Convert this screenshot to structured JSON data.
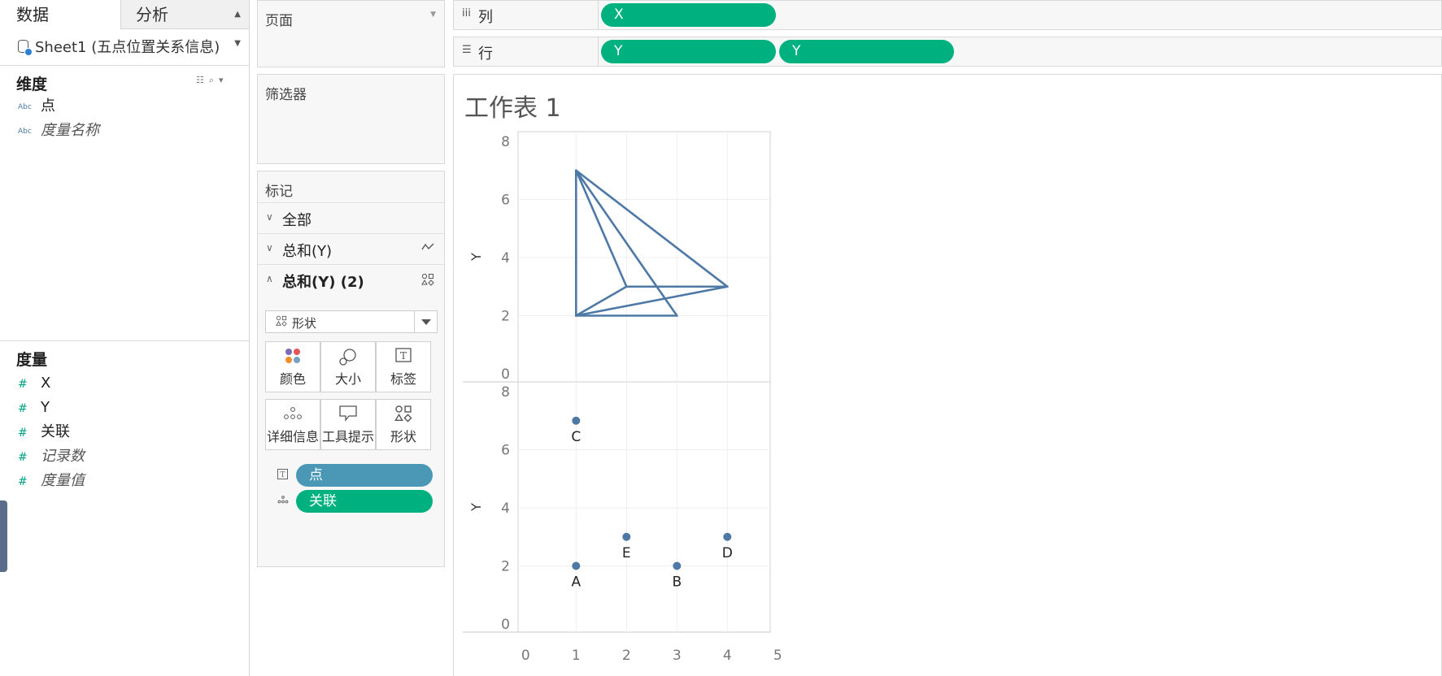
{
  "tabs": {
    "data": "数据",
    "analysis": "分析"
  },
  "datasource": {
    "name": "Sheet1 (五点位置关系信息)"
  },
  "dimensions": {
    "title": "维度",
    "fields": [
      {
        "icon": "abc-icon",
        "label": "点"
      },
      {
        "icon": "abc-icon",
        "label": "度量名称"
      }
    ]
  },
  "measures": {
    "title": "度量",
    "fields": [
      {
        "icon": "hash-icon",
        "label": "X"
      },
      {
        "icon": "hash-icon",
        "label": "Y"
      },
      {
        "icon": "hash-icon",
        "label": "关联"
      },
      {
        "icon": "hash-icon",
        "label": "记录数"
      },
      {
        "icon": "hash-icon",
        "label": "度量值"
      }
    ]
  },
  "cards": {
    "pages": "页面",
    "filters": "筛选器",
    "marks": {
      "title": "标记",
      "rows": [
        {
          "label": "全部",
          "expanded": false
        },
        {
          "label": "总和(Y)",
          "expanded": false,
          "icon": "line-icon"
        },
        {
          "label": "总和(Y) (2)",
          "expanded": true,
          "icon": "shape-icon"
        }
      ],
      "mark_type": "形状",
      "buttons": [
        "颜色",
        "大小",
        "标签",
        "详细信息",
        "工具提示",
        "形状"
      ],
      "pills": [
        {
          "icon": "label-icon",
          "label": "点",
          "color": "#4a98b6"
        },
        {
          "icon": "detail-icon",
          "label": "关联",
          "color": "#00b180"
        }
      ]
    }
  },
  "shelves": {
    "columns": {
      "label": "列",
      "pills": [
        "X"
      ]
    },
    "rows": {
      "label": "行",
      "pills": [
        "Y",
        "Y"
      ]
    }
  },
  "sheet": {
    "title": "工作表 1"
  },
  "colors": {
    "mark": "#4e79a7",
    "pill_green": "#00b180",
    "pill_blue": "#4a98b6"
  },
  "chart_data": [
    {
      "type": "line",
      "title": "",
      "xlabel": "X",
      "ylabel": "Y",
      "ylim": [
        0,
        8
      ],
      "yticks": [
        "0",
        "2",
        "4",
        "6",
        "8"
      ],
      "segments": [
        {
          "from": [
            1,
            7
          ],
          "to": [
            1,
            2
          ]
        },
        {
          "from": [
            1,
            7
          ],
          "to": [
            2,
            3
          ]
        },
        {
          "from": [
            1,
            7
          ],
          "to": [
            3,
            2
          ]
        },
        {
          "from": [
            1,
            7
          ],
          "to": [
            4,
            3
          ]
        },
        {
          "from": [
            1,
            2
          ],
          "to": [
            3,
            2
          ]
        },
        {
          "from": [
            1,
            2
          ],
          "to": [
            2,
            3
          ]
        },
        {
          "from": [
            1,
            2
          ],
          "to": [
            4,
            3
          ]
        },
        {
          "from": [
            2,
            3
          ],
          "to": [
            4,
            3
          ]
        }
      ]
    },
    {
      "type": "scatter",
      "title": "",
      "xlabel": "X",
      "ylabel": "Y",
      "xlim": [
        -1,
        5
      ],
      "ylim": [
        0,
        8
      ],
      "xticks": [
        "0",
        "1",
        "2",
        "3",
        "4",
        "5"
      ],
      "yticks": [
        "0",
        "2",
        "4",
        "6",
        "8"
      ],
      "points": [
        {
          "label": "A",
          "x": 1,
          "y": 2
        },
        {
          "label": "B",
          "x": 3,
          "y": 2
        },
        {
          "label": "C",
          "x": 1,
          "y": 7
        },
        {
          "label": "D",
          "x": 4,
          "y": 3
        },
        {
          "label": "E",
          "x": 2,
          "y": 3
        }
      ]
    }
  ]
}
